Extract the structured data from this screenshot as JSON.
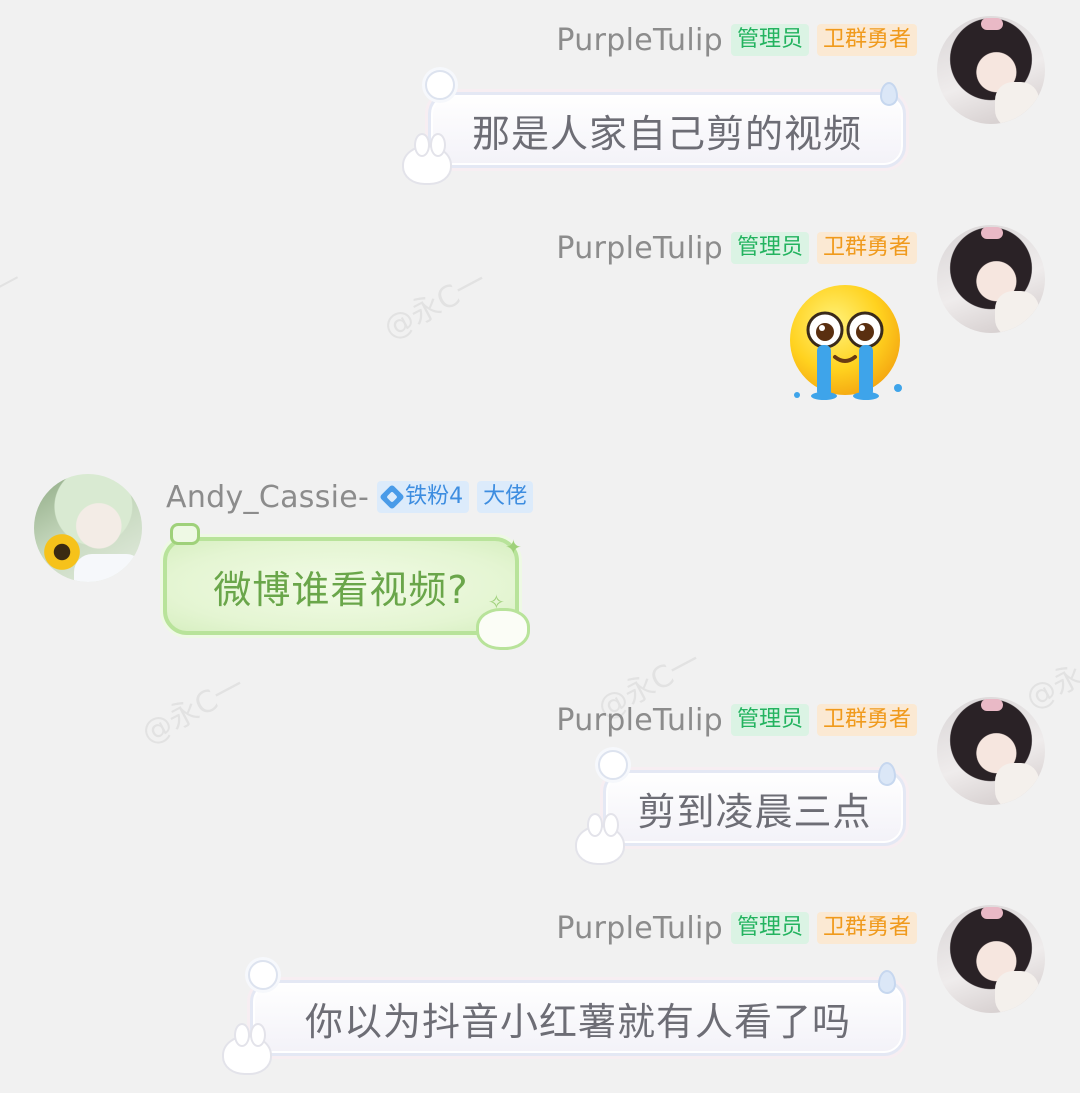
{
  "watermark": "@永C一",
  "messages": [
    {
      "side": "right",
      "username": "PurpleTulip",
      "badges": [
        "管理员",
        "卫群勇者"
      ],
      "text": "那是人家自己剪的视频"
    },
    {
      "side": "right",
      "username": "PurpleTulip",
      "badges": [
        "管理员",
        "卫群勇者"
      ],
      "sticker": "crying-face-emoji"
    },
    {
      "side": "left",
      "username": "Andy_Cassie-",
      "badges": [
        "铁粉4",
        "大佬"
      ],
      "text": "微博谁看视频?"
    },
    {
      "side": "right",
      "username": "PurpleTulip",
      "badges": [
        "管理员",
        "卫群勇者"
      ],
      "text": "剪到凌晨三点"
    },
    {
      "side": "right",
      "username": "PurpleTulip",
      "badges": [
        "管理员",
        "卫群勇者"
      ],
      "text": "你以为抖音小红薯就有人看了吗"
    }
  ],
  "colors": {
    "background": "#f1f1f1",
    "admin_badge": "#23b35f",
    "guard_badge": "#f09a1c",
    "fan_badge": "#3d8de0",
    "green_bubble_text": "#6aa64a"
  }
}
